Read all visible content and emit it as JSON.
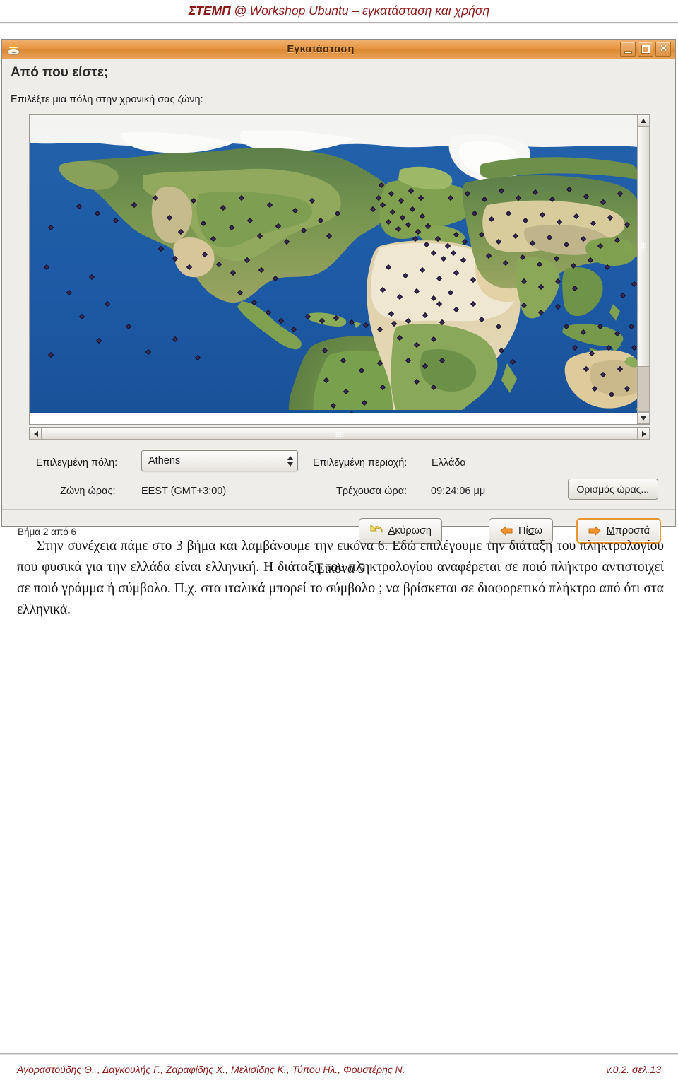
{
  "doc": {
    "header_bold": "ΣΤΕΜΠ @",
    "header_rest": " Workshop Ubuntu – εγκατάσταση και χρήση",
    "caption": "Εικόνα 5",
    "body_text": "Στην συνέχεια πάμε στο 3 βήμα και λαμβάνουμε την εικόνα 6. Εδώ επιλέγουμε την διάταξη του πληκτρολογίου που φυσικά για την ελλάδα είναι ελληνική. Η διάταξη του πληκτρολογίου αναφέρεται σε ποιό πλήκτρο αντιστοιχεί σε ποιό γράμμα ή σύμβολο. Π.χ. στα ιταλικά μπορεί το σύμβολο ; να βρίσκεται σε διαφορετικό πλήκτρο από ότι στα ελληνικά.",
    "footer_authors": "Αγοραστούδης Θ. , Δαγκουλής Γ., Ζαραφίδης Χ., Μελισίδης Κ., Τύπου Ηλ., Φουστέρης Ν.",
    "footer_version": "v.0.2. σελ.13"
  },
  "window": {
    "title": "Εγκατάσταση",
    "icon": "ubuntu-installer-icon",
    "controls": {
      "minimize": "minimize-icon",
      "maximize": "maximize-icon",
      "close": "✕"
    },
    "headline": "Από που είστε;",
    "prompt": "Επιλέξτε μια πόλη στην χρονική σας ζώνη:"
  },
  "map": {
    "name": "world-timezone-map",
    "ocean_color": "#1e5ba6",
    "marker": "city-marker-diamond"
  },
  "form": {
    "city_label": "Επιλεγμένη πόλη:",
    "city_value": "Athens",
    "region_label": "Επιλεγμένη περιοχή:",
    "region_value": "Ελλάδα",
    "timezone_label": "Ζώνη ώρας:",
    "timezone_value": "EEST (GMT+3:00)",
    "current_time_label": "Τρέχουσα ώρα:",
    "current_time_value": "09:24:06 μμ",
    "set_time_button": "Ορισμός ώρας..."
  },
  "footer": {
    "step_text": "Βήμα 2 από 6",
    "cancel_label": "Ακύρωση",
    "back_label": "Πίσω",
    "forward_label": "Μπροστά",
    "cancel_icon": "undo-arrow-icon",
    "back_icon": "arrow-left-icon",
    "forward_icon": "arrow-right-icon",
    "accent_color": "#e8962f"
  }
}
